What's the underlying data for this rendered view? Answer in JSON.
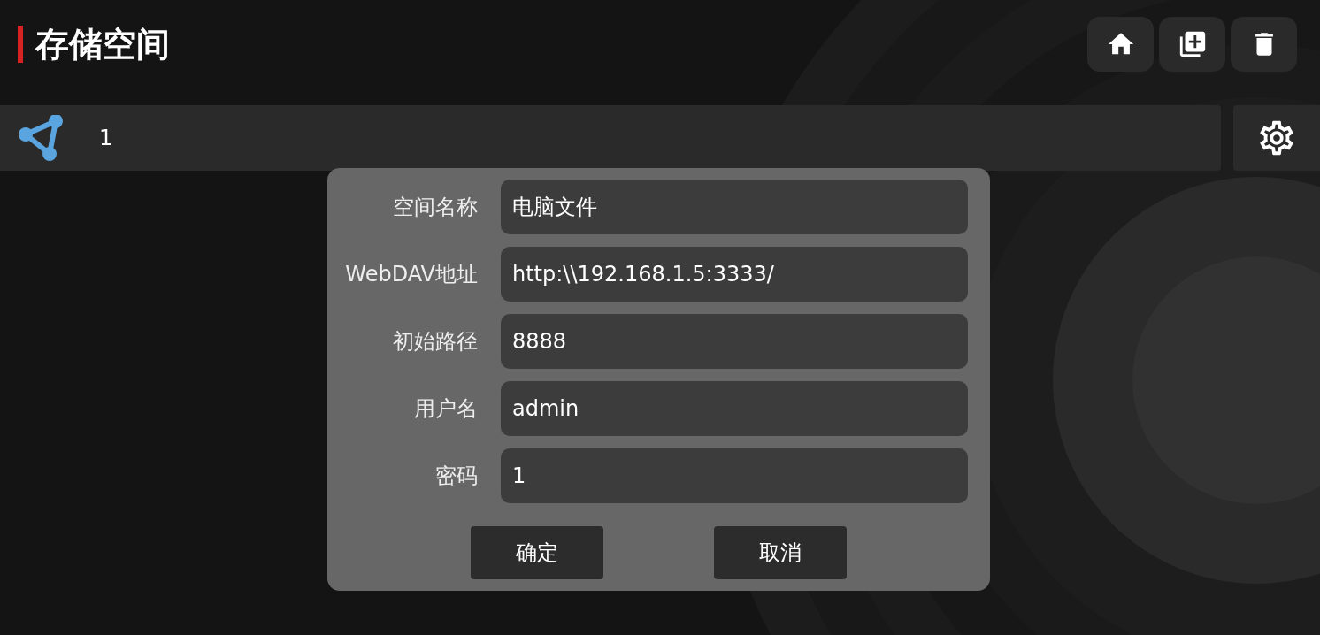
{
  "header": {
    "title": "存储空间"
  },
  "storages": [
    {
      "name": "1"
    }
  ],
  "dialog": {
    "fields": [
      {
        "label": "空间名称",
        "value": "电脑文件"
      },
      {
        "label": "WebDAV地址",
        "value": "http:\\\\192.168.1.5:3333/"
      },
      {
        "label": "初始路径",
        "value": "8888"
      },
      {
        "label": "用户名",
        "value": "admin"
      },
      {
        "label": "密码",
        "value": "1"
      }
    ],
    "buttons": [
      "确定",
      "取消"
    ]
  }
}
